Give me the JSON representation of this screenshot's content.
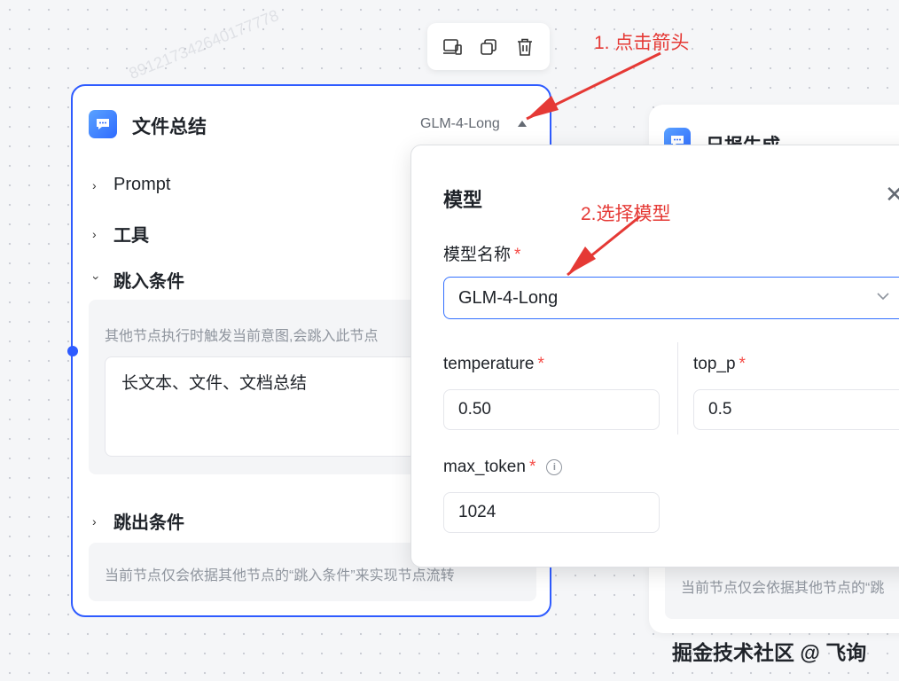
{
  "node": {
    "title": "文件总结",
    "model_label": "GLM-4-Long",
    "sections": {
      "prompt": "Prompt",
      "tools": "工具",
      "jump_in": "跳入条件",
      "jump_out": "跳出条件"
    },
    "jump_in_hint": "其他节点执行时触发当前意图,会跳入此节点",
    "jump_in_value": "长文本、文件、文档总结",
    "jump_out_hint": "当前节点仅会依据其他节点的“跳入条件”来实现节点流转"
  },
  "node2": {
    "title": "日报生成",
    "hint": "当前节点仅会依据其他节点的“跳"
  },
  "popover": {
    "title": "模型",
    "model_name_label": "模型名称",
    "required_mark": "*",
    "model_value": "GLM-4-Long",
    "temperature_label": "temperature",
    "temperature_value": "0.50",
    "top_p_label": "top_p",
    "top_p_value": "0.5",
    "max_token_label": "max_token",
    "max_token_value": "1024",
    "info_glyph": "i",
    "close_glyph": "✕"
  },
  "annotations": {
    "step1": "1. 点击箭头",
    "step2": "2.选择模型"
  },
  "watermark": "891217342640177778",
  "footer": "掘金技术社区 @ 飞询",
  "colors": {
    "accent": "#2e5bff",
    "annotation": "#e53935",
    "required": "#f54a45"
  },
  "icons": [
    "device-icon",
    "copy-icon",
    "trash-icon",
    "chat-bubble-icon",
    "chevron-right-icon",
    "chevron-down-icon",
    "close-icon",
    "info-icon"
  ]
}
